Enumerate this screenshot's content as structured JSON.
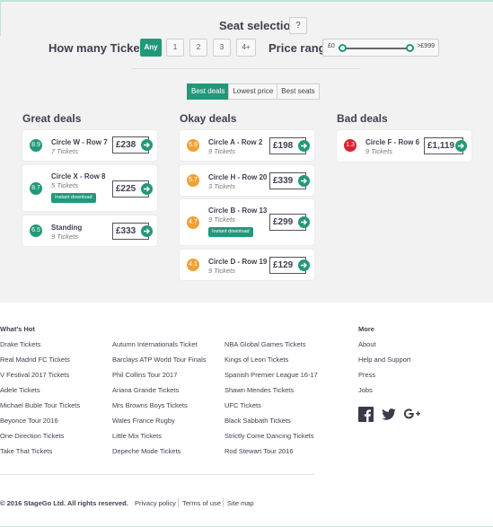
{
  "seat_selection": {
    "title": "Seat selection",
    "help_label": "?",
    "tickets_label": "How many Tickets?",
    "ticket_options": [
      "Any",
      "1",
      "2",
      "3",
      "4+"
    ],
    "selected_ticket_option": "Any",
    "price_label": "Price range",
    "price_min": "£0",
    "price_max": ">£999"
  },
  "tabs": {
    "items": [
      "Best deals",
      "Lowest price",
      "Best seats"
    ],
    "active": "Best deals"
  },
  "columns": {
    "great": {
      "title": "Great deals",
      "deals": [
        {
          "score": "8.9",
          "name": "Circle W - Row 7",
          "tickets": "7 Tickets",
          "price": "£238"
        },
        {
          "score": "8.7",
          "name": "Circle X - Row 8",
          "tickets": "5 Tickets",
          "badge": "Instant download",
          "price": "£225"
        },
        {
          "score": "6.5",
          "name": "Standing",
          "tickets": "9 Tickets",
          "price": "£333"
        }
      ]
    },
    "okay": {
      "title": "Okay deals",
      "deals": [
        {
          "score": "5.9",
          "name": "Circle A - Row 2",
          "tickets": "9 Tickets",
          "price": "£198"
        },
        {
          "score": "5.7",
          "name": "Circle H - Row 20",
          "tickets": "3 Tickets",
          "price": "£339"
        },
        {
          "score": "4.7",
          "name": "Circle B - Row 13",
          "tickets": "9 Tickets",
          "badge": "Instant download",
          "price": "£299"
        },
        {
          "score": "4.1",
          "name": "Circle D - Row 19",
          "tickets": "9 Tickets",
          "price": "£129"
        }
      ]
    },
    "bad": {
      "title": "Bad deals",
      "deals": [
        {
          "score": "1.3",
          "name": "Circle F - Row 6",
          "tickets": "9 Tickets",
          "price": "£1,119"
        }
      ]
    }
  },
  "colors": {
    "accent": "#22987a",
    "score_good": "#22987a",
    "score_okay": "#f0a136",
    "score_bad": "#d9232e"
  },
  "footer": {
    "whats_hot_title": "What's Hot",
    "col1": [
      "Drake Tickets",
      "Real Madrid FC Tickets",
      "V Festival 2017 Tickets",
      "Adele Tickets",
      "Michael Buble Tour Tickets",
      "Beyonce Tour 2016",
      "One Direction Tickets",
      "Take That Tickets"
    ],
    "col2": [
      "Autumn Internationals Ticket",
      "Barclays ATP World Tour Finals",
      "Phil Collins Tour 2017",
      "Ariana Grande Tickets",
      "Mrs Browns Boys Tickets",
      "Wales France Rugby",
      "Little Mix Tickets",
      "Depeche Mode Tickets"
    ],
    "col3": [
      "NBA Global Games Tickets",
      "Kings of Leon Tickets",
      "Spanish Premier League 16-17",
      "Shawn Mendes Tickets",
      "UFC Tickets",
      "Black Sabbath Tickets",
      "Strictly Come Dancing Tickets",
      "Rod Stewart Tour 2016"
    ],
    "more_title": "More",
    "more_links": [
      "About",
      "Help and Support",
      "Press",
      "Jobs"
    ],
    "social_icons": [
      "facebook-icon",
      "twitter-icon",
      "google-plus-icon"
    ],
    "copyright": "© 2016 StageGo Ltd. All rights reserved.",
    "bottom_links": [
      "Privacy policy",
      "Terms of use",
      "Site map"
    ]
  }
}
